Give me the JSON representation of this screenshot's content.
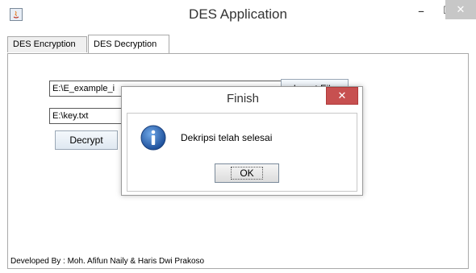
{
  "window": {
    "title": "DES Application",
    "min_glyph": "–",
    "max_glyph": "☐",
    "close_glyph": "✕"
  },
  "tabs": [
    {
      "label": "DES Encryption"
    },
    {
      "label": "DES Decryption"
    }
  ],
  "panel": {
    "input_file_value": "E:\\E_example_i",
    "browse_label": "Insert File",
    "key_file_value": "E:\\key.txt",
    "decrypt_label": "Decrypt",
    "footer": "Developed By : Moh. Afifun Naily & Haris Dwi Prakoso"
  },
  "dialog": {
    "title": "Finish",
    "close_glyph": "✕",
    "message": "Dekripsi telah selesai",
    "ok_label": "OK",
    "icon": "info-icon"
  },
  "colors": {
    "dialog_close_bg": "#c75050",
    "info_icon": "#2d6bb5"
  }
}
